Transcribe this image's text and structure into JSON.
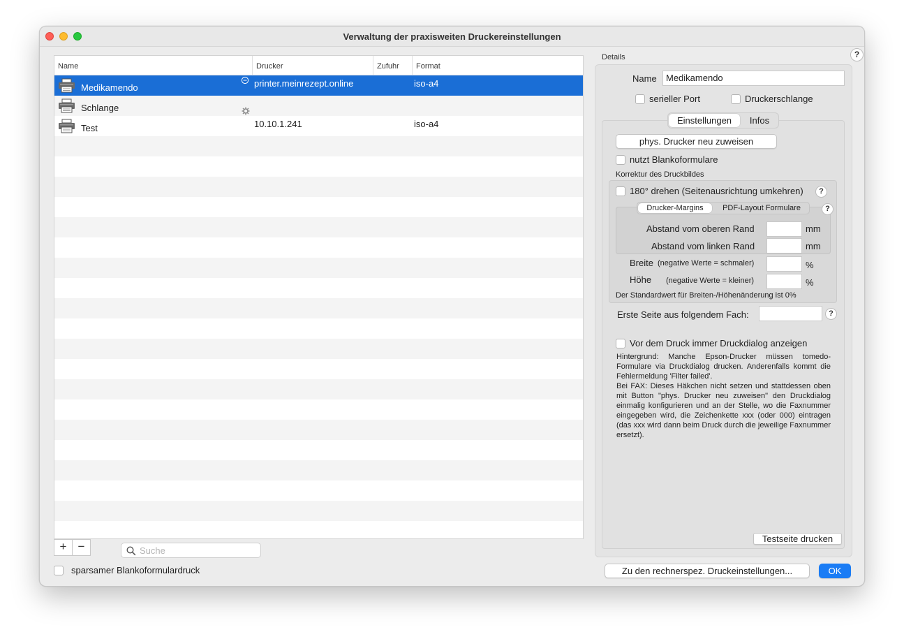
{
  "window": {
    "title": "Verwaltung der praxisweiten Druckereinstellungen"
  },
  "table": {
    "columns": [
      "Name",
      "Drucker",
      "Zufuhr",
      "Format"
    ],
    "rows": [
      {
        "name": "Medikamendo",
        "drucker": "printer.meinrezept.online",
        "zufuhr": "",
        "format": "iso-a4",
        "selected": true,
        "status_icon": "minus-circle-icon"
      },
      {
        "name": "Schlange",
        "drucker": "",
        "zufuhr": "",
        "format": "",
        "selected": false,
        "status_icon": "gear-icon"
      },
      {
        "name": "Test",
        "drucker": "10.10.1.241",
        "zufuhr": "",
        "format": "iso-a4",
        "selected": false,
        "status_icon": ""
      }
    ]
  },
  "toolbar": {
    "add_label": "+",
    "remove_label": "−",
    "search_placeholder": "Suche",
    "sparsamer_label": "sparsamer Blankoformulardruck"
  },
  "details": {
    "title": "Details",
    "help": "?",
    "name_label": "Name",
    "name_value": "Medikamendo",
    "serieller_port": "serieller Port",
    "druckerschlange": "Druckerschlange",
    "tabs": [
      "Einstellungen",
      "Infos"
    ],
    "active_tab": "Einstellungen",
    "reassign_button": "phys. Drucker neu zuweisen",
    "blanko_label": "nutzt Blankoformulare",
    "korrektur_title": "Korrektur des Druckbildes",
    "rotate_label": "180° drehen (Seitenausrichtung umkehren)",
    "subtabs": [
      "Drucker-Margins",
      "PDF-Layout Formulare"
    ],
    "active_subtab": "Drucker-Margins",
    "oben_label": "Abstand vom oberen Rand",
    "links_label": "Abstand vom linken Rand",
    "unit_mm": "mm",
    "breite_label": "Breite",
    "breite_hint": "(negative Werte = schmaler)",
    "hoehe_label": "Höhe",
    "hoehe_hint": "(negative Werte = kleiner)",
    "unit_percent": "%",
    "standard_note": "Der Standardwert für Breiten-/Höhenänderung ist 0%",
    "fach_label": "Erste Seite aus folgendem Fach:",
    "dialog_label": "Vor dem Druck immer Druckdialog anzeigen",
    "hintergrund_text": "Hintergrund: Manche Epson-Drucker müssen tomedo-Formulare via Druckdialog drucken. Anderenfalls kommt die Fehlermeldung 'Filter failed'.",
    "fax_text": "Bei FAX: Dieses Häkchen nicht setzen und stattdessen oben mit Button \"phys. Drucker neu zuweisen\" den Druckdialog einmalig konfigurieren und an der Stelle, wo die Faxnummer eingegeben wird, die Zeichenkette xxx (oder 000) eintragen (das xxx wird dann beim Druck durch die jeweilige Faxnummer ersetzt).",
    "testseite_button": "Testseite drucken"
  },
  "footer": {
    "rechnerspez_button": "Zu den rechnerspez. Druckeinstellungen...",
    "ok_button": "OK"
  },
  "colors": {
    "selection": "#1a6ed6",
    "accent": "#1a7cf5"
  }
}
